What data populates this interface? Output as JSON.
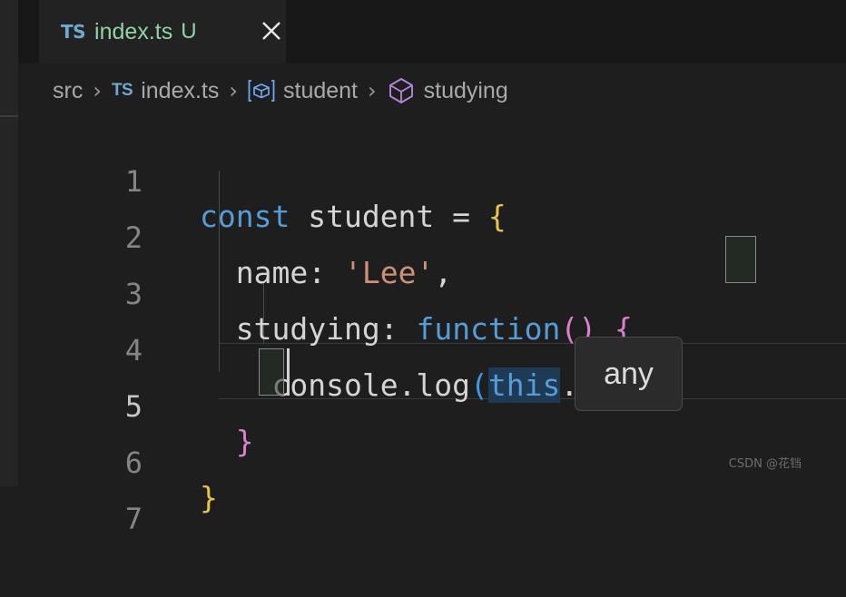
{
  "window": {
    "theme": "dark",
    "background_color": "#1e1e1e"
  },
  "tab_bar": {
    "active_tab": {
      "file_type_badge": "TS",
      "title": "index.ts",
      "git_status": "U",
      "close_icon": "close-icon"
    }
  },
  "breadcrumb": {
    "separator": "›",
    "items": [
      {
        "label": "src",
        "icon": ""
      },
      {
        "label": "index.ts",
        "icon": "typescript-badge",
        "badge": "TS"
      },
      {
        "label": "student",
        "icon": "variable-symbol-icon"
      },
      {
        "label": "studying",
        "icon": "method-symbol-icon"
      }
    ]
  },
  "editor": {
    "language": "typescript",
    "active_line": 5,
    "cursor_column": 4,
    "lines": [
      {
        "number": "1",
        "text": "const student = {"
      },
      {
        "number": "2",
        "text": "  name: 'Lee',"
      },
      {
        "number": "3",
        "text": "  studying: function() {"
      },
      {
        "number": "4",
        "text": "    console.log(this.name)"
      },
      {
        "number": "5",
        "text": "  }"
      },
      {
        "number": "6",
        "text": "}"
      },
      {
        "number": "7",
        "text": ""
      }
    ],
    "tokens": {
      "line1": {
        "kw": "const",
        "sp1": " ",
        "name": "student",
        "eq": " = ",
        "brace": "{"
      },
      "line2": {
        "indent": "  ",
        "key": "name",
        "colon": ": ",
        "str": "'Lee'",
        "comma": ","
      },
      "line3": {
        "indent": "  ",
        "key": "studying",
        "colon": ": ",
        "kw": "function",
        "open_paren": "(",
        "close_paren": ")",
        "space": " ",
        "brace": "{"
      },
      "line4": {
        "indent": "    ",
        "callee": "console.log",
        "open_paren": "(",
        "this": "this",
        "prop": ".name",
        "close_paren": ")"
      },
      "line5": {
        "indent": "  ",
        "brace": "}"
      },
      "line6": {
        "brace": "}"
      }
    },
    "hover_tooltip": {
      "text": "any",
      "visible": true
    },
    "occurrence_highlight": "this",
    "bracket_match_pair": [
      "{",
      "}"
    ]
  },
  "colors": {
    "keyword": "#569cd6",
    "string": "#ce9178",
    "plain_text": "#d4d4d4",
    "brace_yellow": "#e8c44a",
    "brace_pink": "#d980d0",
    "paren_blue": "#3b9ae8",
    "line_number": "#858585",
    "line_number_active": "#c6c6c6",
    "tab_title_untracked": "#8fd4a2",
    "typescript_badge": "#6fa8d0",
    "variable_icon": "#6fa8f2",
    "method_icon": "#b584d8",
    "selection_bg": "#1f3a54"
  },
  "watermark": {
    "text": "CSDN @花铛"
  }
}
